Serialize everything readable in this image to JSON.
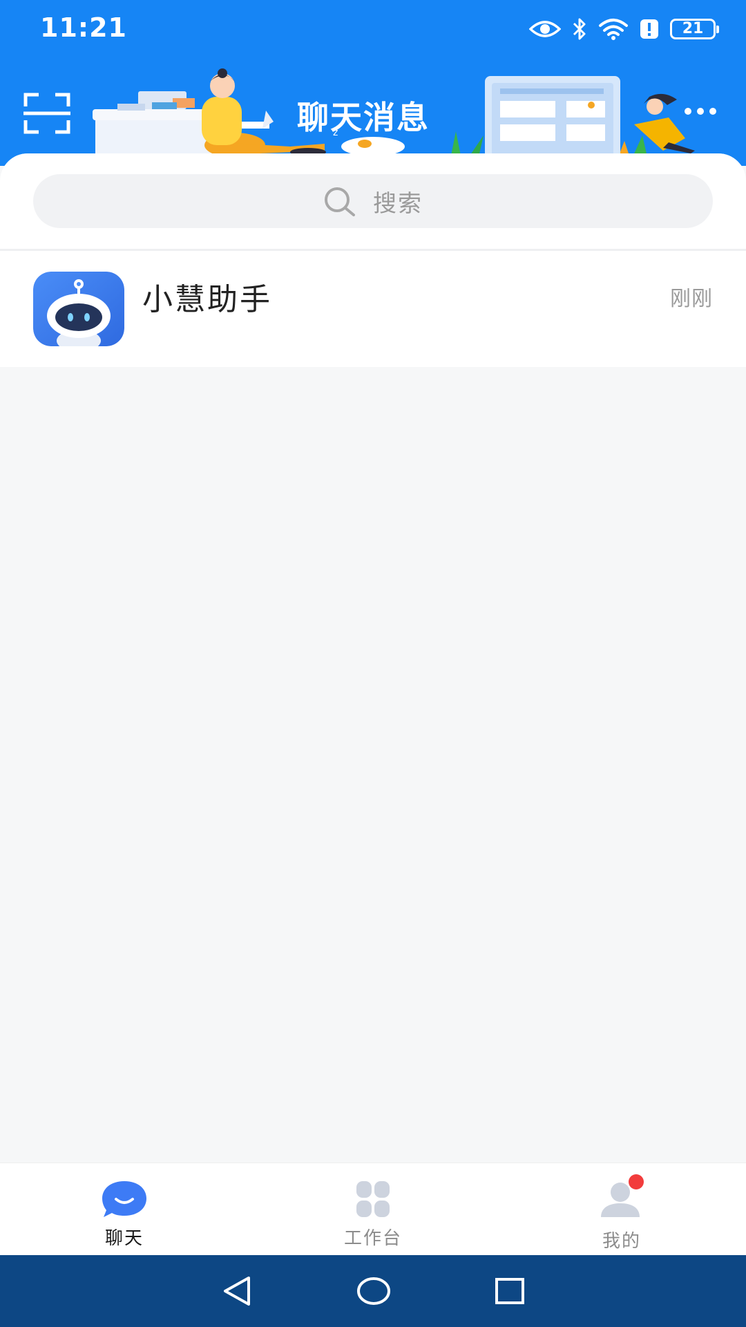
{
  "status_bar": {
    "time": "11:21",
    "battery_level": "21",
    "icons": [
      "eye-icon",
      "bluetooth-icon",
      "wifi-icon",
      "alert-icon",
      "battery-icon"
    ]
  },
  "header": {
    "title": "聊天消息",
    "left_icon": "scan-icon",
    "right_icon": "more-icon",
    "background_color": "#1685f5"
  },
  "search": {
    "placeholder": "搜索"
  },
  "chats": [
    {
      "name": "小慧助手",
      "time": "刚刚",
      "avatar": "robot-avatar"
    }
  ],
  "tabs": [
    {
      "label": "聊天",
      "icon": "chat-bubble-icon",
      "active": true
    },
    {
      "label": "工作台",
      "icon": "grid-icon",
      "active": false
    },
    {
      "label": "我的",
      "icon": "user-icon",
      "active": false,
      "badge": true
    }
  ],
  "colors": {
    "accent": "#1685f5",
    "tab_active": "#3d7bf5",
    "tab_inactive": "#cdd3de",
    "badge": "#f23c3c",
    "nav_bar": "#0d4784"
  },
  "system_nav": {
    "buttons": [
      "back-icon",
      "home-icon",
      "recents-icon"
    ]
  }
}
